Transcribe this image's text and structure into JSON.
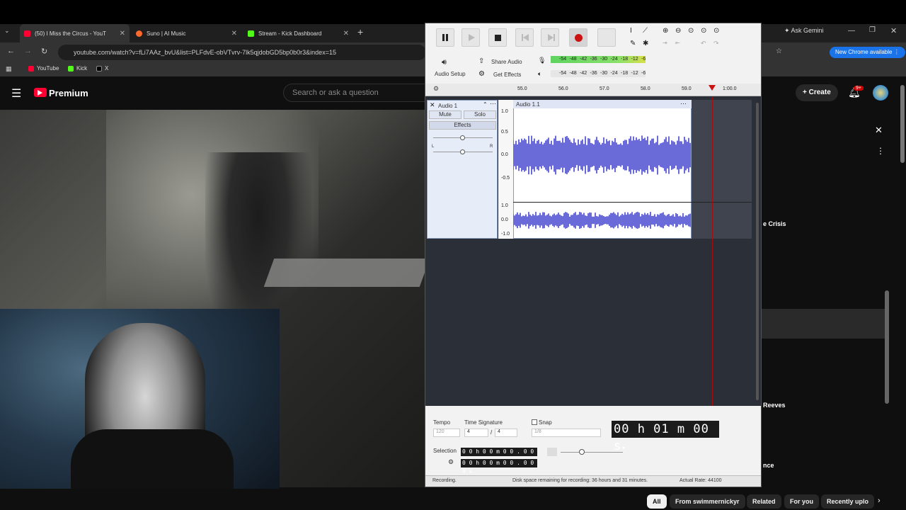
{
  "browser": {
    "tabs": [
      {
        "label": "(50) I Miss the Circus - YouT",
        "color": "#ff0033"
      },
      {
        "label": "Suno | AI Music",
        "color": "#ff6a2c"
      },
      {
        "label": "Stream - Kick Dashboard",
        "color": "#53fc18"
      }
    ],
    "url": "youtube.com/watch?v=fLi7AAz_bvU&list=PLFdvE-obVTvrv-7lk5qjdobGD5bp0b0r3&index=15",
    "bookmarks": [
      "YouTube",
      "Kick",
      "X"
    ],
    "new_chrome_label": "New Chrome available",
    "ask_gemini_label": "Ask Gemini"
  },
  "youtube": {
    "logo_label": "Premium",
    "search_placeholder": "Search or ask a question",
    "create_label": "Create",
    "notification_count": "9+",
    "side_texts": [
      "e Crisis",
      "Reeves",
      "nce"
    ],
    "chips": [
      "All",
      "From swimmernickyr",
      "Related",
      "For you",
      "Recently uplo"
    ]
  },
  "audacity": {
    "share_audio_label": "Share Audio",
    "get_effects_label": "Get Effects",
    "audio_setup_label": "Audio Setup",
    "meter_ticks": [
      "-54",
      "-48",
      "-42",
      "-36",
      "-30",
      "-24",
      "-18",
      "-12",
      "-6"
    ],
    "ruler_ticks": [
      "55.0",
      "56.0",
      "57.0",
      "58.0",
      "59.0",
      "1:00.0"
    ],
    "track_name": "Audio 1",
    "mute_label": "Mute",
    "solo_label": "Solo",
    "effects_label": "Effects",
    "clip_name": "Audio 1.1",
    "y_ticks_top": [
      "1.0",
      "0.5",
      "0.0",
      "-0.5"
    ],
    "y_ticks_bottom": [
      "1.0",
      "0.0",
      "-1.0"
    ],
    "tempo_label": "Tempo",
    "tempo_value": "120",
    "time_signature_label": "Time Signature",
    "ts_num": "4",
    "ts_den": "4",
    "snap_label": "Snap",
    "snap_value": "1/8",
    "time_display": "00 h 01 m 00 s",
    "selection_label": "Selection",
    "selection_start": "0 0 h 0 0 m 0 0 . 0 0 0 s",
    "selection_end": "0 0 h 0 0 m 0 0 . 0 0 0 s",
    "status_left": "Recording.",
    "status_mid": "Disk space remaining for recording: 36 hours and 31 minutes.",
    "status_right": "Actual Rate: 44100"
  }
}
